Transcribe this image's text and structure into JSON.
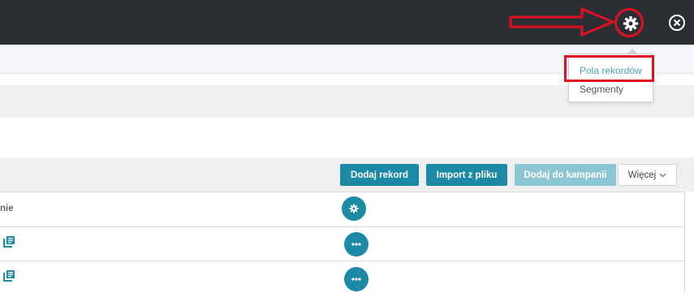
{
  "topbar": {
    "icons": {
      "settings": "gear-icon",
      "close": "close-circle-icon"
    }
  },
  "settings_menu": {
    "items": [
      {
        "label": "Pola rekordów"
      },
      {
        "label": "Segmenty"
      }
    ]
  },
  "toolbar": {
    "add_record": "Dodaj rekord",
    "import_file": "Import z pliku",
    "add_to_campaign": "Dodaj do kampanii",
    "more": "Więcej"
  },
  "table": {
    "header_fragment": "nie",
    "row_action_icon": "more-dots-icon",
    "settings_icon": "gear-icon"
  },
  "colors": {
    "topbar": "#2b2e33",
    "accent": "#1d8aa5",
    "accent_disabled": "#8cc5d4",
    "annotation": "#e01020",
    "menu_active": "#4aa3b0"
  }
}
